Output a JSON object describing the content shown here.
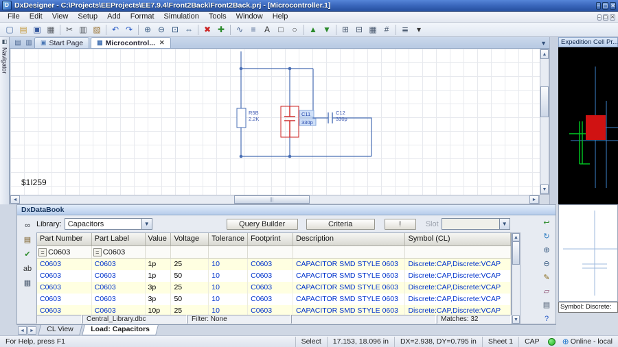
{
  "window": {
    "title": "DxDesigner - C:\\Projects\\EEProjects\\EE7.9.4\\Front2Back\\Front2Back.prj - [Microcontroller.1]",
    "controls": [
      {
        "name": "minimize-button",
        "glyph": "–"
      },
      {
        "name": "maximize-button",
        "glyph": "▢"
      },
      {
        "name": "close-button",
        "glyph": "✕"
      }
    ],
    "mdi_controls": [
      {
        "name": "mdi-minimize-button",
        "glyph": "–"
      },
      {
        "name": "mdi-restore-button",
        "glyph": "▢"
      },
      {
        "name": "mdi-close-button",
        "glyph": "✕"
      }
    ]
  },
  "menubar": {
    "items": [
      "File",
      "Edit",
      "View",
      "Setup",
      "Add",
      "Format",
      "Simulation",
      "Tools",
      "Window",
      "Help"
    ]
  },
  "toolbar": {
    "icons": [
      {
        "name": "new-icon",
        "glyph": "▢",
        "color": "#4a6fa5"
      },
      {
        "name": "open-icon",
        "glyph": "▤",
        "color": "#c49a3f"
      },
      {
        "name": "save-icon",
        "glyph": "▣",
        "color": "#35589e"
      },
      {
        "name": "print-icon",
        "glyph": "▦",
        "color": "#5a5f66"
      },
      {
        "name": "separator"
      },
      {
        "name": "cut-icon",
        "glyph": "✂",
        "color": "#555a61"
      },
      {
        "name": "copy-icon",
        "glyph": "▥",
        "color": "#555a61"
      },
      {
        "name": "paste-icon",
        "glyph": "▧",
        "color": "#9a7436"
      },
      {
        "name": "separator"
      },
      {
        "name": "undo-icon",
        "glyph": "↶",
        "color": "#2457c5"
      },
      {
        "name": "redo-icon",
        "glyph": "↷",
        "color": "#2457c5"
      },
      {
        "name": "separator"
      },
      {
        "name": "zoom-in-icon",
        "glyph": "⊕",
        "color": "#33567e"
      },
      {
        "name": "zoom-out-icon",
        "glyph": "⊖",
        "color": "#33567e"
      },
      {
        "name": "zoom-fit-icon",
        "glyph": "⊡",
        "color": "#33567e"
      },
      {
        "name": "pan-icon",
        "glyph": "⇔",
        "color": "#33567e"
      },
      {
        "name": "separator"
      },
      {
        "name": "delete-icon",
        "glyph": "✖",
        "color": "#cc2525"
      },
      {
        "name": "add-icon",
        "glyph": "✚",
        "color": "#2a8a2a"
      },
      {
        "name": "separator"
      },
      {
        "name": "net-icon",
        "glyph": "∿",
        "color": "#44608c"
      },
      {
        "name": "bus-icon",
        "glyph": "≡",
        "color": "#44608c"
      },
      {
        "name": "text-icon",
        "glyph": "A",
        "color": "#333333"
      },
      {
        "name": "rectangle-icon",
        "glyph": "□",
        "color": "#444444"
      },
      {
        "name": "circle-icon",
        "glyph": "○",
        "color": "#444444"
      },
      {
        "name": "separator"
      },
      {
        "name": "move-up-icon",
        "glyph": "▲",
        "color": "#2a8a2a"
      },
      {
        "name": "move-down-icon",
        "glyph": "▼",
        "color": "#2a8a2a"
      },
      {
        "name": "separator"
      },
      {
        "name": "grid-icon",
        "glyph": "⊞",
        "color": "#4a5a70"
      },
      {
        "name": "align-icon",
        "glyph": "⊟",
        "color": "#4a5a70"
      },
      {
        "name": "distribute-icon",
        "glyph": "▦",
        "color": "#4a5a70"
      },
      {
        "name": "snap-icon",
        "glyph": "#",
        "color": "#4a5a70"
      },
      {
        "name": "separator"
      },
      {
        "name": "properties-icon",
        "glyph": "≣",
        "color": "#4a5a70"
      },
      {
        "name": "toolbar-options-icon",
        "glyph": "▾",
        "color": "#333333"
      }
    ]
  },
  "tabbar": {
    "tabs": [
      {
        "label": "Start Page"
      },
      {
        "label": "Microcontrol..."
      }
    ]
  },
  "navigator": {
    "label": "Navigator"
  },
  "schematic": {
    "net_label": "$1I259",
    "components": [
      {
        "ref": "R5B",
        "value": "2.2K"
      },
      {
        "ref": "C11",
        "value": "330p"
      },
      {
        "ref": "C12",
        "value": "330p"
      }
    ]
  },
  "cell_panel": {
    "title": "Expedition Cell Pr...",
    "symbol_caption": "Symbol: Discrete:"
  },
  "databook": {
    "title": "DxDataBook",
    "library_label": "Library:",
    "library_value": "Capacitors",
    "buttons": {
      "query_builder": "Query Builder",
      "criteria": "Criteria",
      "bang": "!",
      "slot_label": "Slot"
    },
    "left_tools": [
      {
        "name": "binoculars-icon",
        "glyph": "∞",
        "color": "#3a3f46"
      },
      {
        "name": "export-icon",
        "glyph": "▤",
        "color": "#7a5a20"
      },
      {
        "name": "green-check-icon",
        "glyph": "✔",
        "color": "#2a8a2a"
      },
      {
        "name": "ab-text-icon",
        "glyph": "ab",
        "color": "#333333"
      },
      {
        "name": "grid-view-icon",
        "glyph": "▦",
        "color": "#4a5a70"
      }
    ],
    "right_tools": [
      {
        "name": "place-symbol-icon",
        "glyph": "↩",
        "color": "#2a8a2a"
      },
      {
        "name": "refresh-icon",
        "glyph": "↻",
        "color": "#2a7ac0"
      },
      {
        "name": "zoom-in-icon",
        "glyph": "⊕",
        "color": "#33567e"
      },
      {
        "name": "zoom-out-icon",
        "glyph": "⊖",
        "color": "#33567e"
      },
      {
        "name": "pencil-icon",
        "glyph": "✎",
        "color": "#8a6d1f"
      },
      {
        "name": "eraser-icon",
        "glyph": "▱",
        "color": "#8a4a6d"
      },
      {
        "name": "chip-icon",
        "glyph": "▤",
        "color": "#4a5a70"
      },
      {
        "name": "help-icon",
        "glyph": "?",
        "color": "#2457c5"
      }
    ],
    "table": {
      "headers": [
        "Part Number",
        "Part Label",
        "Value",
        "Voltage",
        "Tolerance",
        "Footprint",
        "Description",
        "Symbol (CL)"
      ],
      "filter_operator": "=",
      "filter": [
        "C0603",
        "C0603",
        "",
        "",
        "",
        "",
        "",
        ""
      ],
      "rows": [
        [
          "C0603",
          "C0603",
          "1p",
          "25",
          "10",
          "C0603",
          "CAPACITOR SMD STYLE 0603",
          "Discrete:CAP,Discrete:VCAP"
        ],
        [
          "C0603",
          "C0603",
          "1p",
          "50",
          "10",
          "C0603",
          "CAPACITOR SMD STYLE 0603",
          "Discrete:CAP,Discrete:VCAP"
        ],
        [
          "C0603",
          "C0603",
          "3p",
          "25",
          "10",
          "C0603",
          "CAPACITOR SMD STYLE 0603",
          "Discrete:CAP,Discrete:VCAP"
        ],
        [
          "C0603",
          "C0603",
          "3p",
          "50",
          "10",
          "C0603",
          "CAPACITOR SMD STYLE 0603",
          "Discrete:CAP,Discrete:VCAP"
        ],
        [
          "C0603",
          "C0603",
          "10p",
          "25",
          "10",
          "C0603",
          "CAPACITOR SMD STYLE 0603",
          "Discrete:CAP,Discrete:VCAP"
        ]
      ]
    },
    "footer": {
      "library_file": "Central_Library.dbc",
      "filter": "Filter: None",
      "matches": "Matches: 32"
    }
  },
  "bottom_tabs": {
    "tabs": [
      "CL View",
      "Load: Capacitors"
    ],
    "active": "Load: Capacitors"
  },
  "statusbar": {
    "help": "For Help, press F1",
    "mode": "Select",
    "coords": "17.153, 18.096 in",
    "delta": "DX=2.938, DY=0.795 in",
    "sheet": "Sheet 1",
    "part": "CAP",
    "online": "Online - local"
  },
  "colors": {
    "titlebar": "#2a56a8",
    "link": "#0033cc",
    "selection": "#cc2222",
    "wire": "#4a6fb5",
    "row_alt": "#ffffe1",
    "led": "#1db21d"
  }
}
